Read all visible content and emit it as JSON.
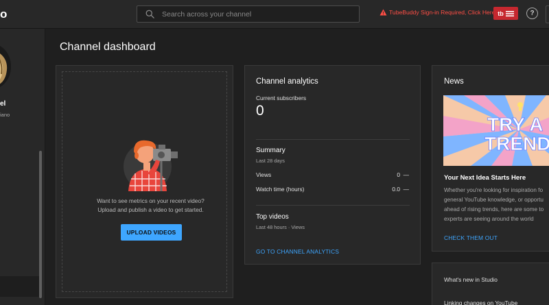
{
  "topbar": {
    "logo_fragment": "o",
    "search_placeholder": "Search across your channel",
    "tubebuddy_warning": "TubeBuddy Sign-in Required, Click Here",
    "tubebuddy_button_label": "tb",
    "help_label": "?"
  },
  "sidebar": {
    "channel_name": "el",
    "channel_sub": "iano"
  },
  "main": {
    "page_title": "Channel dashboard",
    "upload_card": {
      "line1": "Want to see metrics on your recent video?",
      "line2": "Upload and publish a video to get started.",
      "button_label": "UPLOAD VIDEOS"
    },
    "analytics_card": {
      "title": "Channel analytics",
      "subscribers_label": "Current subscribers",
      "subscribers_value": "0",
      "summary_title": "Summary",
      "summary_period": "Last 28 days",
      "rows": [
        {
          "label": "Views",
          "value": "0",
          "trend": "—"
        },
        {
          "label": "Watch time (hours)",
          "value": "0.0",
          "trend": "—"
        }
      ],
      "top_videos_title": "Top videos",
      "top_videos_period": "Last 48 hours · Views",
      "link_label": "GO TO CHANNEL ANALYTICS"
    },
    "news_card": {
      "title": "News",
      "banner_line1": "TRY A",
      "banner_line2": "TREND",
      "headline": "Your Next Idea Starts Here",
      "body_lines": [
        "Whether you're looking for inspiration fo",
        "general YouTube knowledge, or opportu",
        "ahead of rising trends, here are some to",
        "experts are seeing around the world"
      ],
      "link_label": "CHECK THEM OUT"
    },
    "whats_new_card": {
      "title": "What's new in Studio",
      "item": "Linking changes on YouTube"
    }
  },
  "colors": {
    "background": "#1f1f1f",
    "surface": "#282828",
    "accent_blue": "#3ea6ff",
    "tubebuddy_red": "#c6282f",
    "warning_red": "#ff4e45"
  }
}
